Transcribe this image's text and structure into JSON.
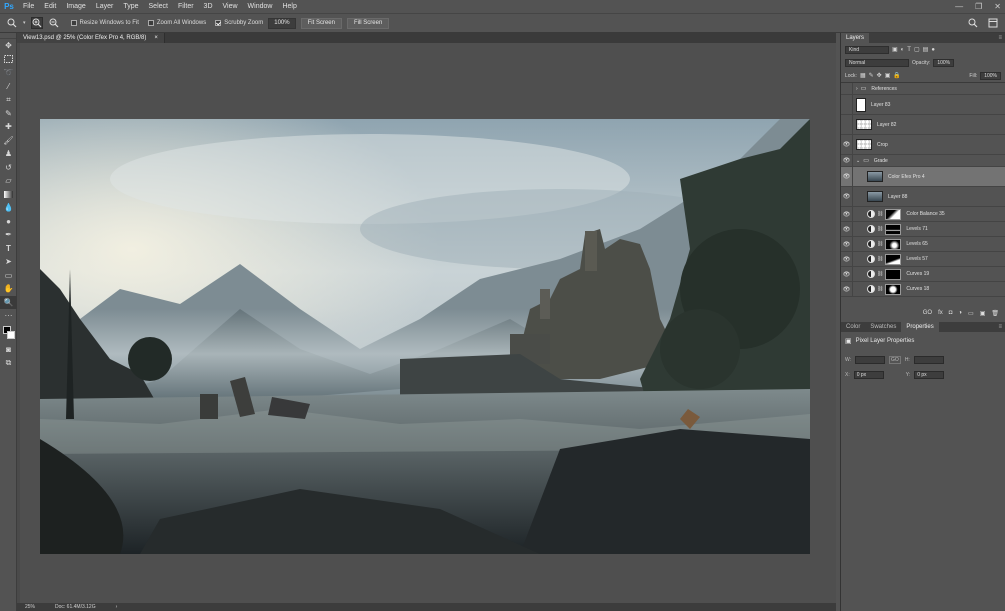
{
  "app": {
    "logo": "Ps"
  },
  "menu": [
    "File",
    "Edit",
    "Image",
    "Layer",
    "Type",
    "Select",
    "Filter",
    "3D",
    "View",
    "Window",
    "Help"
  ],
  "window_controls": [
    "—",
    "❐",
    "✕"
  ],
  "options": {
    "resize_windows": "Resize Windows to Fit",
    "zoom_all": "Zoom All Windows",
    "scrubby_zoom": "Scrubby Zoom",
    "zoom_value": "100%",
    "fit_screen": "Fit Screen",
    "fill_screen": "Fill Screen"
  },
  "doc": {
    "tab_title": "View13.psd @ 25% (Color Efex Pro 4, RGB/8)",
    "tab_close": "×",
    "zoom": "25%",
    "doc_size": "Doc: 61.4M/3.12G",
    "arrow": "›"
  },
  "layers_panel": {
    "tab": "Layers",
    "kind": "Kind",
    "blend": "Normal",
    "opacity_label": "Opacity:",
    "opacity": "100%",
    "lock_label": "Lock:",
    "fill_label": "Fill:",
    "fill": "100%",
    "layers": [
      {
        "name": "References",
        "type": "group",
        "visible": false
      },
      {
        "name": "Layer 83",
        "type": "pixel-white",
        "visible": false
      },
      {
        "name": "Layer 82",
        "type": "pixel-check",
        "visible": false
      },
      {
        "name": "Crop",
        "type": "pixel-check",
        "visible": true
      },
      {
        "name": "Grade",
        "type": "group-open",
        "visible": true
      },
      {
        "name": "Color Efex Pro 4",
        "type": "pixel-img",
        "visible": true,
        "selected": true
      },
      {
        "name": "Layer 88",
        "type": "pixel-img",
        "visible": true
      },
      {
        "name": "Color Balance 35",
        "type": "adj",
        "visible": true
      },
      {
        "name": "Levels 71",
        "type": "adj",
        "visible": true
      },
      {
        "name": "Levels 65",
        "type": "adj",
        "visible": true
      },
      {
        "name": "Levels 57",
        "type": "adj",
        "visible": true
      },
      {
        "name": "Curves 19",
        "type": "adj",
        "visible": true
      },
      {
        "name": "Curves 18",
        "type": "adj",
        "visible": true
      }
    ],
    "footer": [
      "GO",
      "fx",
      "◘",
      "◑",
      "▭",
      "▣",
      "🗑"
    ]
  },
  "props_panel": {
    "tabs": [
      "Color",
      "Swatches",
      "Properties"
    ],
    "active": "Properties",
    "title": "Pixel Layer Properties",
    "w_label": "W:",
    "h_label": "H:",
    "x_label": "X:",
    "y_label": "Y:",
    "go": "GO",
    "x": "0 px",
    "y": "0 px"
  }
}
